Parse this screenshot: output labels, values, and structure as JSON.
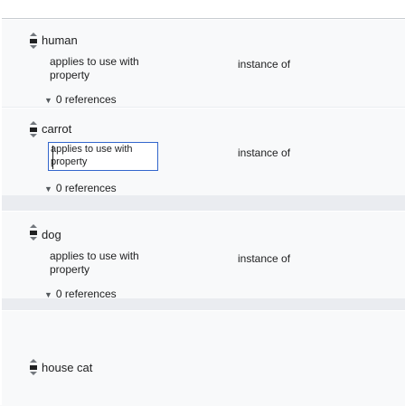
{
  "statements": [
    {
      "value": "human",
      "qualifier_property": "applies to use with property",
      "qualifier_value": "instance of",
      "references": "0 references"
    },
    {
      "value": "carrot",
      "qualifier_property": "applies to use with property",
      "qualifier_value": "instance of",
      "references": "0 references"
    },
    {
      "value": "dog",
      "qualifier_property": "applies to use with property",
      "qualifier_value": "instance of",
      "references": "0 references"
    },
    {
      "value": "house cat"
    }
  ],
  "icons": {
    "rank": "rank-selector-icon",
    "references_toggle": "caret-down-icon"
  }
}
